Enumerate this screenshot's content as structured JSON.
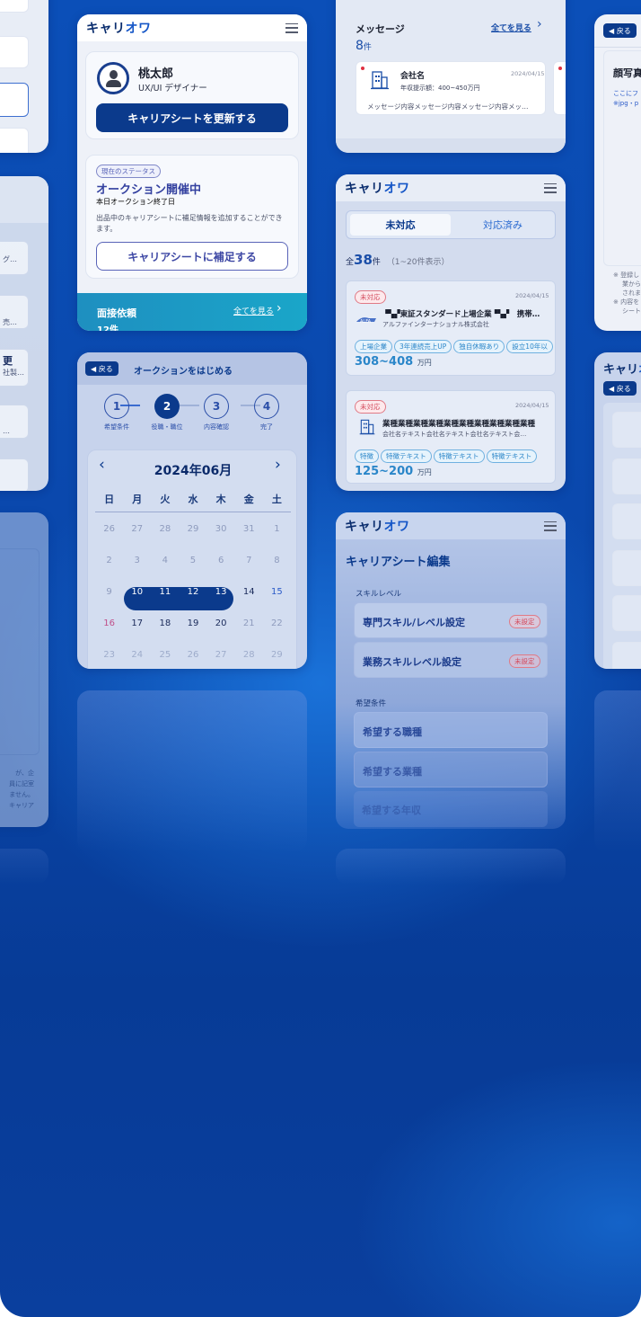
{
  "app": {
    "logo_prefix": "キャリ",
    "logo_suffix": "オワ"
  },
  "profile_card": {
    "name": "桃太郎",
    "role": "UX/UI デザイナー",
    "update_button": "キャリアシートを更新する",
    "status_tag": "現在のステータス",
    "status_title": "オークション開催中",
    "status_sub": "本日オークション終了日",
    "status_desc": "出品中のキャリアシートに補足情報を追加することができます。",
    "supplement_button": "キャリアシートに補足する",
    "interview_label": "面接依頼",
    "interview_link": "全てを見る",
    "interview_count": "12件"
  },
  "message_card": {
    "title": "メッセージ",
    "link": "全てを見る",
    "count": "8",
    "count_unit": "件",
    "company": "会社名",
    "date": "2024/04/15",
    "salary": "年収提示額：400~450万円",
    "preview": "メッセージ内容メッセージ内容メッセージ内容メッ…"
  },
  "offer_card": {
    "tab_pending": "未対応",
    "tab_done": "対応済み",
    "total_prefix": "全",
    "total": "38",
    "total_unit": "件",
    "range": "（1~20件表示）",
    "items": [
      {
        "badge": "未対応",
        "date": "2024/04/15",
        "title": "▝▚▞東証スタンダード上場企業▝▚▞　携帯…",
        "company": "アルファインターナショナル株式会社",
        "tags": [
          "上場企業",
          "3年連続売上UP",
          "独自休暇あり",
          "設立10年以"
        ],
        "salary": "308~408",
        "unit": "万円"
      },
      {
        "badge": "未対応",
        "date": "2024/04/15",
        "title": "業種業種業種業種業種業種業種業種業種業種",
        "company": "会社名テキスト会社名テキスト会社名テキスト会…",
        "tags": [
          "特徴",
          "特徴テキスト",
          "特徴テキスト",
          "特徴テキスト"
        ],
        "salary": "125~200",
        "unit": "万円"
      }
    ]
  },
  "auction_card": {
    "back": "戻る",
    "title": "オークションをはじめる",
    "steps": [
      {
        "num": "1",
        "label": "希望条件"
      },
      {
        "num": "2",
        "label": "役職・職位"
      },
      {
        "num": "3",
        "label": "内容確認"
      },
      {
        "num": "4",
        "label": "完了"
      }
    ],
    "month": "2024年06月",
    "weekdays": [
      "日",
      "月",
      "火",
      "水",
      "木",
      "金",
      "土"
    ],
    "weeks": [
      [
        "26",
        "27",
        "28",
        "29",
        "30",
        "31",
        "1"
      ],
      [
        "2",
        "3",
        "4",
        "5",
        "6",
        "7",
        "8"
      ],
      [
        "9",
        "10",
        "11",
        "12",
        "13",
        "14",
        "15"
      ],
      [
        "16",
        "17",
        "18",
        "19",
        "20",
        "21",
        "22"
      ],
      [
        "23",
        "24",
        "25",
        "26",
        "27",
        "28",
        "29"
      ]
    ]
  },
  "edit_card": {
    "title": "キャリアシート編集",
    "skill_section": "スキルレベル",
    "skill_items": [
      "専門スキル/レベル設定",
      "業務スキルレベル設定"
    ],
    "unset": "未設定",
    "wish_section": "希望条件",
    "wish_items": [
      "希望する職種",
      "希望する業種",
      "希望する年収"
    ]
  },
  "photo_card": {
    "back": "戻る",
    "title": "顔写真",
    "line1": "ここにフ",
    "line2": "※jpg・p",
    "notes": [
      "※ 登録し",
      "業から",
      "されま",
      "※ 内容を",
      "シート"
    ]
  },
  "left_card": {
    "rows": [
      "グ…",
      "売…",
      "社製…",
      "…"
    ],
    "heading_char": "更"
  },
  "left_bottom": {
    "lines": [
      "が、企",
      "員に記室",
      "ません。",
      "キャリア"
    ]
  },
  "colors": {
    "primary": "#0b3a8c",
    "accent": "#1556c7",
    "teal": "#1aa6c9",
    "background": "#0a47ab"
  }
}
